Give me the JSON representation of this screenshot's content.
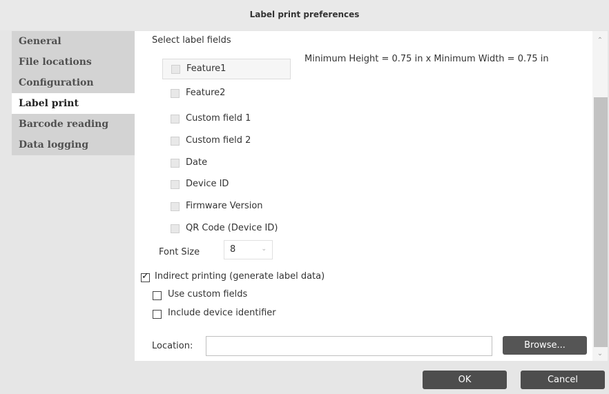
{
  "window": {
    "title": "Label print preferences"
  },
  "sidebar": {
    "items": [
      {
        "label": "General"
      },
      {
        "label": "File locations"
      },
      {
        "label": "Configuration"
      },
      {
        "label": "Label print",
        "active": true
      },
      {
        "label": "Barcode reading"
      },
      {
        "label": "Data logging"
      }
    ]
  },
  "content": {
    "section_label": "Select label fields",
    "min_size_text": "Minimum Height = 0.75 in  x  Minimum Width = 0.75 in",
    "fields": [
      {
        "label": "Feature1",
        "checked": false,
        "enabled": false
      },
      {
        "label": "Feature2",
        "checked": false,
        "enabled": false
      },
      {
        "label": "Custom field 1",
        "checked": false,
        "enabled": false
      },
      {
        "label": "Custom field 2",
        "checked": false,
        "enabled": false
      },
      {
        "label": "Date",
        "checked": false,
        "enabled": false
      },
      {
        "label": "Device ID",
        "checked": false,
        "enabled": false
      },
      {
        "label": "Firmware Version",
        "checked": false,
        "enabled": false
      },
      {
        "label": "QR Code (Device ID)",
        "checked": false,
        "enabled": false
      }
    ],
    "font_size": {
      "label": "Font Size",
      "value": "8"
    },
    "indirect_printing": {
      "label": "Indirect printing (generate label data)",
      "checked": true
    },
    "use_custom_fields": {
      "label": "Use custom fields",
      "checked": false
    },
    "include_device_identifier": {
      "label": "Include device identifier",
      "checked": false
    },
    "location": {
      "label": "Location:",
      "value": "",
      "browse_label": "Browse..."
    }
  },
  "footer": {
    "ok_label": "OK",
    "cancel_label": "Cancel"
  },
  "icons": {
    "scroll_up": "chevron-up-icon",
    "scroll_down": "chevron-down-icon",
    "dropdown": "chevron-down-icon",
    "check": "checkmark-icon"
  }
}
